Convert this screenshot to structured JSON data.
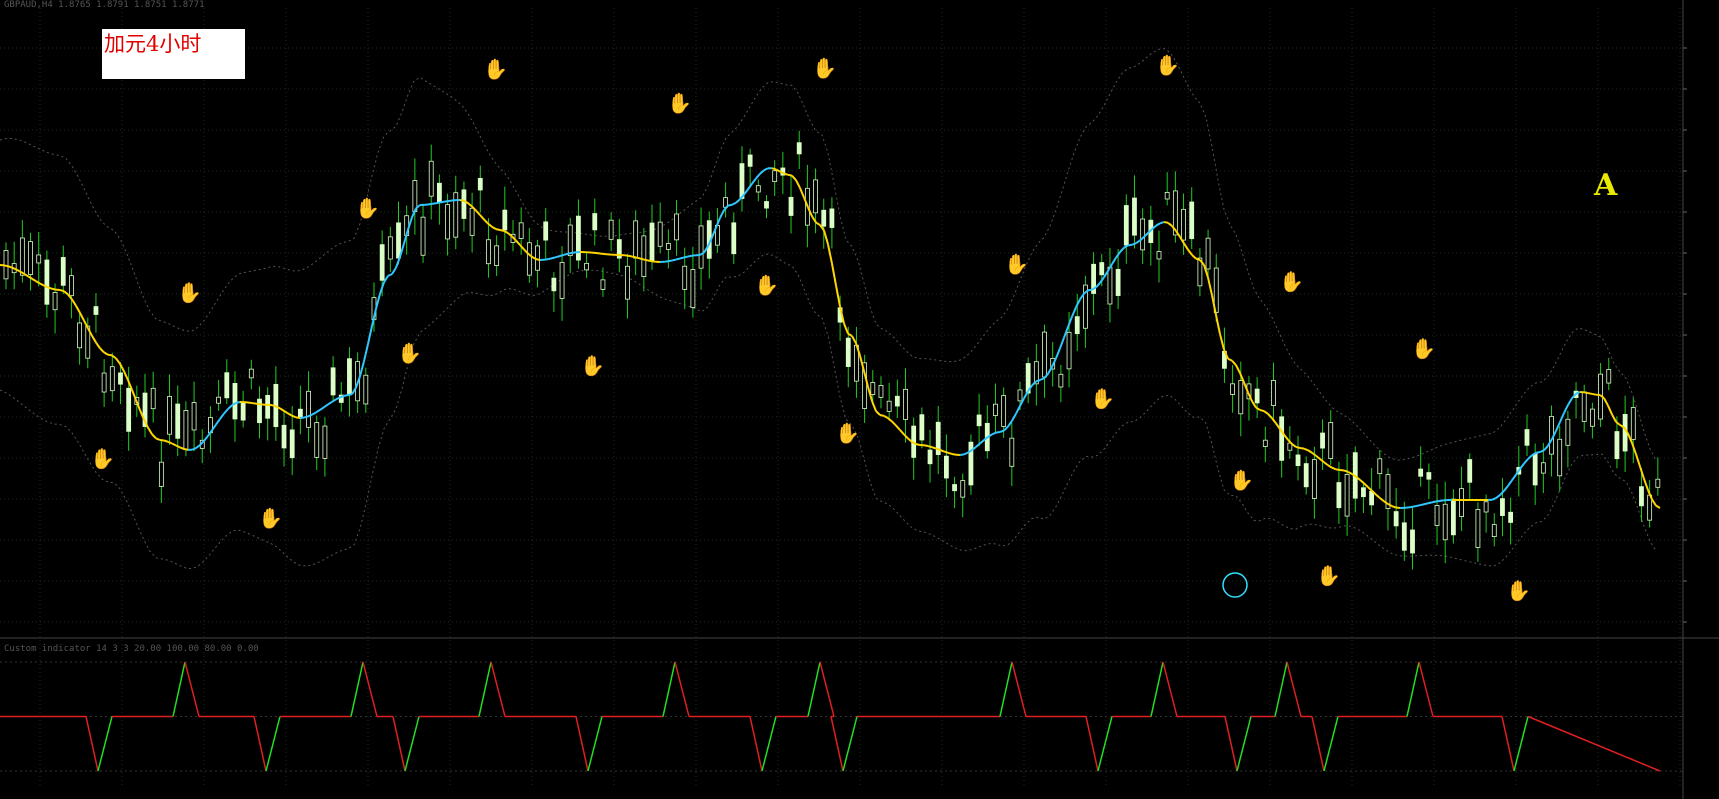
{
  "window": {
    "header_text": "GBPAUD,H4  1.8765 1.8791 1.8751 1.8771",
    "subwindow_header": "Custom indicator 14 3 3  20.00 100.00 80.00 0.00"
  },
  "annotations": {
    "label_text": "加元4小时",
    "big_letter": "A"
  },
  "chart_data": {
    "type": "candlestick",
    "main": {
      "price_range": [
        0.0,
        1.0
      ],
      "candle_count": 203,
      "overlays": [
        "bollinger-bands",
        "trend-ma"
      ],
      "up_color": "#dcffc8",
      "down_color": "#dcffc8",
      "wick_color": "#22cc22",
      "ma_up_color": "#30c8ff",
      "ma_down_color": "#ffd700",
      "band_color": "#555555",
      "grid": "dotted",
      "sell_signals": [
        185,
        363,
        491,
        675,
        820,
        1012,
        1163,
        1287,
        1419
      ],
      "buy_signals": [
        98,
        266,
        405,
        588,
        762,
        843,
        1098,
        1237,
        1324,
        1514
      ],
      "circle_marker_at": 1235
    },
    "oscillator": {
      "levels": [
        0,
        50,
        100
      ],
      "up_color": "#22e022",
      "down_color": "#e02020"
    }
  },
  "colors": {
    "background": "#000000",
    "grid": "#1e2a1e",
    "label_bg": "#ffffff",
    "label_text": "#e00000",
    "letter": "#e8e800",
    "sell_hand": "#e02020",
    "buy_hand": "#30a0ff"
  }
}
